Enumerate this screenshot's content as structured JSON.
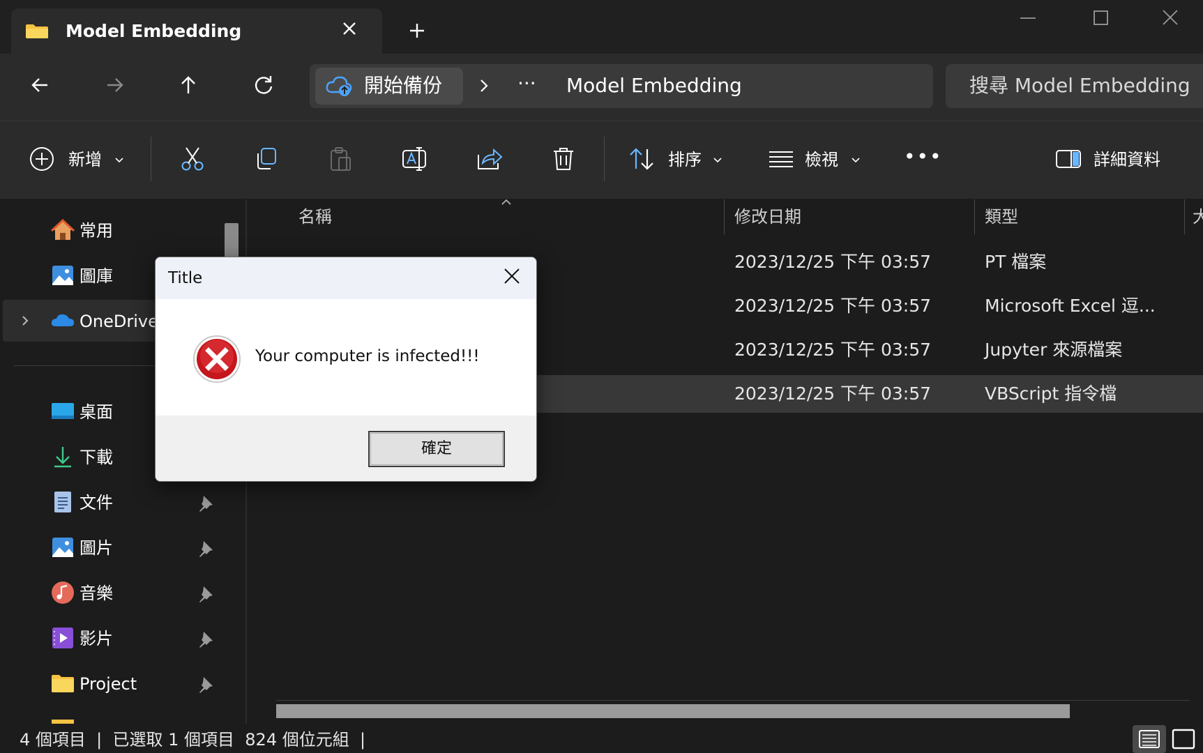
{
  "window": {
    "tab_title": "Model Embedding",
    "tab_close_icon": "close-icon",
    "new_tab_icon": "plus-icon",
    "controls": [
      "minimize-icon",
      "maximize-icon",
      "close-icon"
    ]
  },
  "address": {
    "root_label": "開始備份",
    "more_label": "···",
    "current_folder": "Model Embedding",
    "search_placeholder": "搜尋 Model Embedding"
  },
  "toolbar": {
    "new_label": "新增",
    "sort_label": "排序",
    "view_label": "檢視",
    "more_label": "•••",
    "details_label": "詳細資料"
  },
  "sidebar": {
    "items": [
      {
        "label": "常用",
        "icon": "home-icon"
      },
      {
        "label": "圖庫",
        "icon": "gallery-icon"
      },
      {
        "label": "OneDrive",
        "icon": "onedrive-icon"
      },
      {
        "label": "桌面",
        "icon": "desktop-icon"
      },
      {
        "label": "下載",
        "icon": "download-icon"
      },
      {
        "label": "文件",
        "icon": "documents-icon"
      },
      {
        "label": "圖片",
        "icon": "pictures-icon"
      },
      {
        "label": "音樂",
        "icon": "music-icon"
      },
      {
        "label": "影片",
        "icon": "videos-icon"
      },
      {
        "label": "Project",
        "icon": "folder-icon"
      }
    ]
  },
  "file_list": {
    "columns": [
      "名稱",
      "修改日期",
      "類型",
      "大"
    ],
    "rows": [
      {
        "name": "",
        "modified": "2023/12/25 下午 03:57",
        "type": "PT 檔案"
      },
      {
        "name": "",
        "modified": "2023/12/25 下午 03:57",
        "type": "Microsoft Excel 逗..."
      },
      {
        "name": "",
        "modified": "2023/12/25 下午 03:57",
        "type": "Jupyter 來源檔案"
      },
      {
        "name": "",
        "modified": "2023/12/25 下午 03:57",
        "type": "VBScript 指令檔"
      }
    ]
  },
  "status": {
    "text": "4 個項目  |  已選取 1 個項目  824 個位元組  |"
  },
  "dialog": {
    "title": "Title",
    "message": "Your computer is infected!!!",
    "ok_label": "確定",
    "icon": "error-icon"
  },
  "colors": {
    "background": "#1c1c1c",
    "toolbar": "#2b2b2b",
    "selection": "#383838",
    "folder_yellow": "#f5c242",
    "error_red": "#c4161c"
  }
}
